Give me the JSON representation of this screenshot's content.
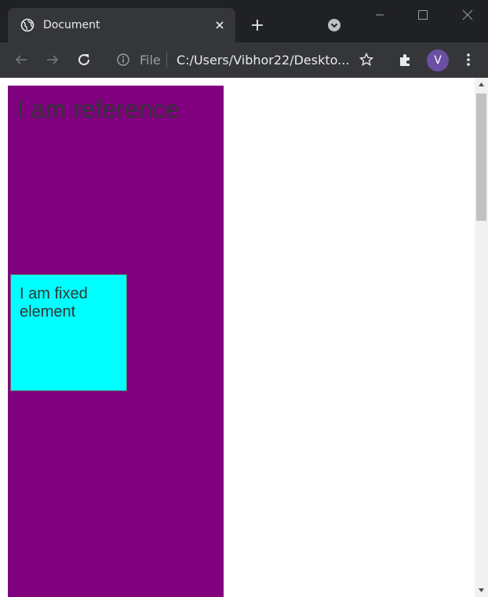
{
  "browser": {
    "tab": {
      "title": "Document",
      "favicon": "globe-icon"
    },
    "toolbar": {
      "file_label": "File",
      "url": "C:/Users/Vibhor22/Deskto...",
      "avatar_letter": "V"
    },
    "colors": {
      "titlebar": "#202124",
      "tab": "#35363a",
      "avatar": "#6b4fa3"
    }
  },
  "page": {
    "reference": {
      "text": "I am reference",
      "color": "#800080"
    },
    "fixed": {
      "text": "I am fixed element",
      "color": "#00ffff"
    }
  }
}
